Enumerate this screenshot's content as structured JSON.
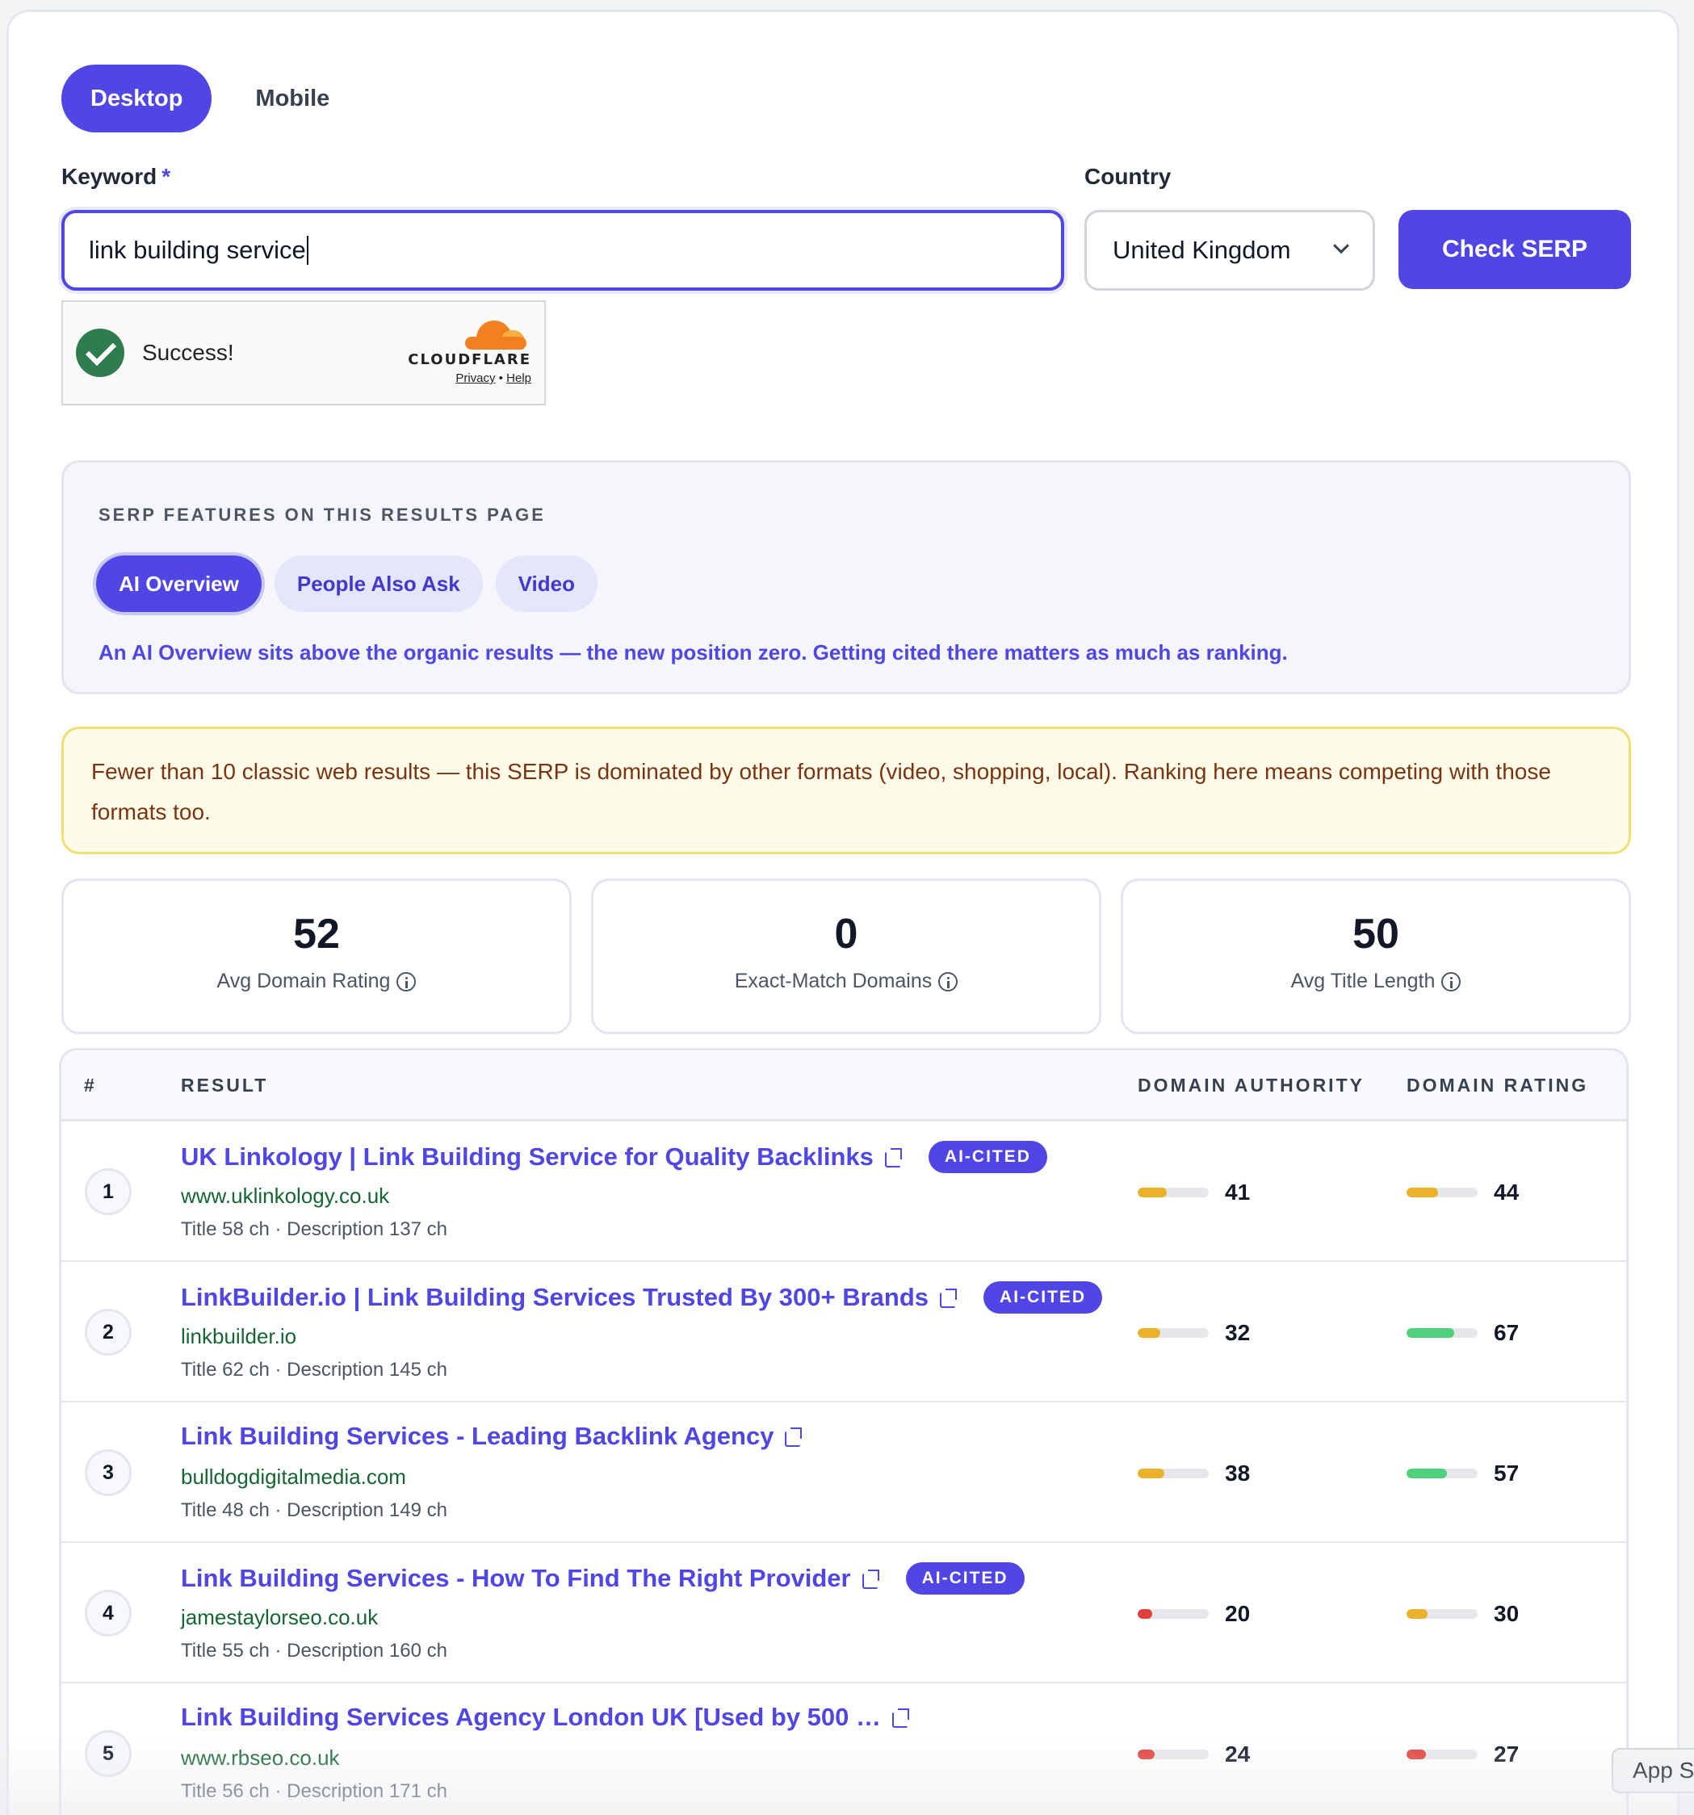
{
  "device_tabs": [
    {
      "label": "Desktop",
      "active": true
    },
    {
      "label": "Mobile",
      "active": false
    }
  ],
  "form": {
    "keyword_label": "Keyword",
    "required_mark": "*",
    "keyword_value": "link building service",
    "country_label": "Country",
    "country_value": "United Kingdom",
    "submit_label": "Check SERP"
  },
  "captcha": {
    "status": "Success!",
    "brand": "CLOUDFLARE",
    "privacy": "Privacy",
    "separator": "•",
    "help": "Help"
  },
  "serp_features": {
    "title": "SERP FEATURES ON THIS RESULTS PAGE",
    "chips": [
      "AI Overview",
      "People Also Ask",
      "Video"
    ],
    "active_chip": "AI Overview",
    "note": "An AI Overview sits above the organic results — the new position zero. Getting cited there matters as much as ranking."
  },
  "warning": "Fewer than 10 classic web results — this SERP is dominated by other formats (video, shopping, local). Ranking here means competing with those formats too.",
  "stats": [
    {
      "value": "52",
      "label": "Avg Domain Rating"
    },
    {
      "value": "0",
      "label": "Exact-Match Domains"
    },
    {
      "value": "50",
      "label": "Avg Title Length"
    }
  ],
  "table": {
    "headers": [
      "#",
      "RESULT",
      "DOMAIN AUTHORITY",
      "DOMAIN RATING"
    ],
    "rows": [
      {
        "rank": "1",
        "title": "UK Linkology | Link Building Service for Quality Backlinks",
        "badge": "AI-CITED",
        "url": "www.uklinkology.co.uk",
        "meta": "Title 58 ch · Description 137 ch",
        "da": "41",
        "dr": "44",
        "da_fill": 0.41,
        "dr_fill": 0.44,
        "da_color": "#eab12b",
        "dr_color": "#eab12b"
      },
      {
        "rank": "2",
        "title": "LinkBuilder.io | Link Building Services Trusted By 300+ Brands",
        "badge": "AI-CITED",
        "url": "linkbuilder.io",
        "meta": "Title 62 ch · Description 145 ch",
        "da": "32",
        "dr": "67",
        "da_fill": 0.32,
        "dr_fill": 0.67,
        "da_color": "#eab12b",
        "dr_color": "#4fd07a"
      },
      {
        "rank": "3",
        "title": "Link Building Services - Leading Backlink Agency",
        "badge": "",
        "url": "bulldogdigitalmedia.com",
        "meta": "Title 48 ch · Description 149 ch",
        "da": "38",
        "dr": "57",
        "da_fill": 0.38,
        "dr_fill": 0.57,
        "da_color": "#eab12b",
        "dr_color": "#4fd07a"
      },
      {
        "rank": "4",
        "title": "Link Building Services - How To Find The Right Provider",
        "badge": "AI-CITED",
        "url": "jamestaylorseo.co.uk",
        "meta": "Title 55 ch · Description 160 ch",
        "da": "20",
        "dr": "30",
        "da_fill": 0.2,
        "dr_fill": 0.3,
        "da_color": "#e0413c",
        "dr_color": "#eab12b"
      },
      {
        "rank": "5",
        "title": "Link Building Services Agency London UK [Used by 500 …",
        "badge": "",
        "url": "www.rbseo.co.uk",
        "meta": "Title 56 ch · Description 171 ch",
        "da": "24",
        "dr": "27",
        "da_fill": 0.24,
        "dr_fill": 0.27,
        "da_color": "#e0413c",
        "dr_color": "#e0413c"
      }
    ]
  },
  "app_chip": "App S"
}
